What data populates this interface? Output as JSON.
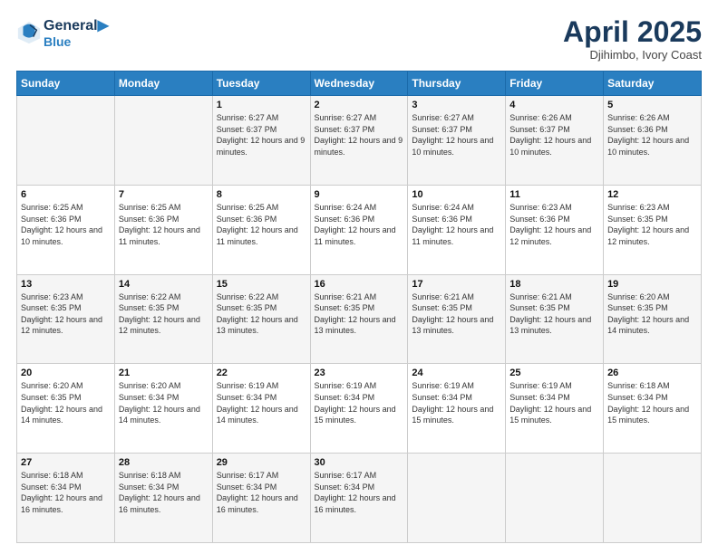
{
  "header": {
    "logo_line1": "General",
    "logo_line2": "Blue",
    "month_title": "April 2025",
    "subtitle": "Djihimbo, Ivory Coast"
  },
  "weekdays": [
    "Sunday",
    "Monday",
    "Tuesday",
    "Wednesday",
    "Thursday",
    "Friday",
    "Saturday"
  ],
  "weeks": [
    [
      {
        "day": "",
        "sunrise": "",
        "sunset": "",
        "daylight": ""
      },
      {
        "day": "",
        "sunrise": "",
        "sunset": "",
        "daylight": ""
      },
      {
        "day": "1",
        "sunrise": "Sunrise: 6:27 AM",
        "sunset": "Sunset: 6:37 PM",
        "daylight": "Daylight: 12 hours and 9 minutes."
      },
      {
        "day": "2",
        "sunrise": "Sunrise: 6:27 AM",
        "sunset": "Sunset: 6:37 PM",
        "daylight": "Daylight: 12 hours and 9 minutes."
      },
      {
        "day": "3",
        "sunrise": "Sunrise: 6:27 AM",
        "sunset": "Sunset: 6:37 PM",
        "daylight": "Daylight: 12 hours and 10 minutes."
      },
      {
        "day": "4",
        "sunrise": "Sunrise: 6:26 AM",
        "sunset": "Sunset: 6:37 PM",
        "daylight": "Daylight: 12 hours and 10 minutes."
      },
      {
        "day": "5",
        "sunrise": "Sunrise: 6:26 AM",
        "sunset": "Sunset: 6:36 PM",
        "daylight": "Daylight: 12 hours and 10 minutes."
      }
    ],
    [
      {
        "day": "6",
        "sunrise": "Sunrise: 6:25 AM",
        "sunset": "Sunset: 6:36 PM",
        "daylight": "Daylight: 12 hours and 10 minutes."
      },
      {
        "day": "7",
        "sunrise": "Sunrise: 6:25 AM",
        "sunset": "Sunset: 6:36 PM",
        "daylight": "Daylight: 12 hours and 11 minutes."
      },
      {
        "day": "8",
        "sunrise": "Sunrise: 6:25 AM",
        "sunset": "Sunset: 6:36 PM",
        "daylight": "Daylight: 12 hours and 11 minutes."
      },
      {
        "day": "9",
        "sunrise": "Sunrise: 6:24 AM",
        "sunset": "Sunset: 6:36 PM",
        "daylight": "Daylight: 12 hours and 11 minutes."
      },
      {
        "day": "10",
        "sunrise": "Sunrise: 6:24 AM",
        "sunset": "Sunset: 6:36 PM",
        "daylight": "Daylight: 12 hours and 11 minutes."
      },
      {
        "day": "11",
        "sunrise": "Sunrise: 6:23 AM",
        "sunset": "Sunset: 6:36 PM",
        "daylight": "Daylight: 12 hours and 12 minutes."
      },
      {
        "day": "12",
        "sunrise": "Sunrise: 6:23 AM",
        "sunset": "Sunset: 6:35 PM",
        "daylight": "Daylight: 12 hours and 12 minutes."
      }
    ],
    [
      {
        "day": "13",
        "sunrise": "Sunrise: 6:23 AM",
        "sunset": "Sunset: 6:35 PM",
        "daylight": "Daylight: 12 hours and 12 minutes."
      },
      {
        "day": "14",
        "sunrise": "Sunrise: 6:22 AM",
        "sunset": "Sunset: 6:35 PM",
        "daylight": "Daylight: 12 hours and 12 minutes."
      },
      {
        "day": "15",
        "sunrise": "Sunrise: 6:22 AM",
        "sunset": "Sunset: 6:35 PM",
        "daylight": "Daylight: 12 hours and 13 minutes."
      },
      {
        "day": "16",
        "sunrise": "Sunrise: 6:21 AM",
        "sunset": "Sunset: 6:35 PM",
        "daylight": "Daylight: 12 hours and 13 minutes."
      },
      {
        "day": "17",
        "sunrise": "Sunrise: 6:21 AM",
        "sunset": "Sunset: 6:35 PM",
        "daylight": "Daylight: 12 hours and 13 minutes."
      },
      {
        "day": "18",
        "sunrise": "Sunrise: 6:21 AM",
        "sunset": "Sunset: 6:35 PM",
        "daylight": "Daylight: 12 hours and 13 minutes."
      },
      {
        "day": "19",
        "sunrise": "Sunrise: 6:20 AM",
        "sunset": "Sunset: 6:35 PM",
        "daylight": "Daylight: 12 hours and 14 minutes."
      }
    ],
    [
      {
        "day": "20",
        "sunrise": "Sunrise: 6:20 AM",
        "sunset": "Sunset: 6:35 PM",
        "daylight": "Daylight: 12 hours and 14 minutes."
      },
      {
        "day": "21",
        "sunrise": "Sunrise: 6:20 AM",
        "sunset": "Sunset: 6:34 PM",
        "daylight": "Daylight: 12 hours and 14 minutes."
      },
      {
        "day": "22",
        "sunrise": "Sunrise: 6:19 AM",
        "sunset": "Sunset: 6:34 PM",
        "daylight": "Daylight: 12 hours and 14 minutes."
      },
      {
        "day": "23",
        "sunrise": "Sunrise: 6:19 AM",
        "sunset": "Sunset: 6:34 PM",
        "daylight": "Daylight: 12 hours and 15 minutes."
      },
      {
        "day": "24",
        "sunrise": "Sunrise: 6:19 AM",
        "sunset": "Sunset: 6:34 PM",
        "daylight": "Daylight: 12 hours and 15 minutes."
      },
      {
        "day": "25",
        "sunrise": "Sunrise: 6:19 AM",
        "sunset": "Sunset: 6:34 PM",
        "daylight": "Daylight: 12 hours and 15 minutes."
      },
      {
        "day": "26",
        "sunrise": "Sunrise: 6:18 AM",
        "sunset": "Sunset: 6:34 PM",
        "daylight": "Daylight: 12 hours and 15 minutes."
      }
    ],
    [
      {
        "day": "27",
        "sunrise": "Sunrise: 6:18 AM",
        "sunset": "Sunset: 6:34 PM",
        "daylight": "Daylight: 12 hours and 16 minutes."
      },
      {
        "day": "28",
        "sunrise": "Sunrise: 6:18 AM",
        "sunset": "Sunset: 6:34 PM",
        "daylight": "Daylight: 12 hours and 16 minutes."
      },
      {
        "day": "29",
        "sunrise": "Sunrise: 6:17 AM",
        "sunset": "Sunset: 6:34 PM",
        "daylight": "Daylight: 12 hours and 16 minutes."
      },
      {
        "day": "30",
        "sunrise": "Sunrise: 6:17 AM",
        "sunset": "Sunset: 6:34 PM",
        "daylight": "Daylight: 12 hours and 16 minutes."
      },
      {
        "day": "",
        "sunrise": "",
        "sunset": "",
        "daylight": ""
      },
      {
        "day": "",
        "sunrise": "",
        "sunset": "",
        "daylight": ""
      },
      {
        "day": "",
        "sunrise": "",
        "sunset": "",
        "daylight": ""
      }
    ]
  ]
}
